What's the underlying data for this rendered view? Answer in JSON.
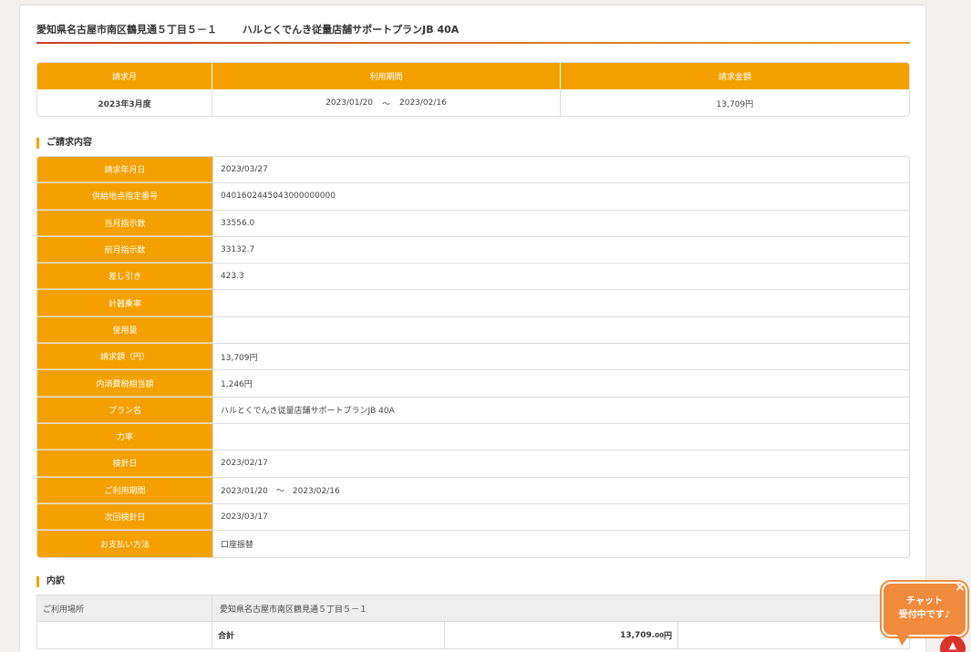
{
  "header": {
    "address": "愛知県名古屋市南区鶴見通５丁目５－１",
    "plan": "ハルとくでんき従量店舗サポートプランJB 40A"
  },
  "summary": {
    "headers": [
      "請求月",
      "利用期間",
      "請求金額"
    ],
    "month": "2023年3月度",
    "period_start": "2023/01/20",
    "period_sep": "〜",
    "period_end": "2023/02/16",
    "amount": "13,709円"
  },
  "details": {
    "heading": "ご請求内容",
    "rows": [
      {
        "label": "請求年月日",
        "value": "2023/03/27"
      },
      {
        "label": "供給地点指定番号",
        "value": "0401602445043000000000"
      },
      {
        "label": "当月指示数",
        "value": "33556.0"
      },
      {
        "label": "前月指示数",
        "value": "33132.7"
      },
      {
        "label": "差し引き",
        "value": "423.3"
      },
      {
        "label": "計器乗率",
        "value": ""
      },
      {
        "label": "使用量",
        "value": ""
      },
      {
        "label": "請求額（円）",
        "value": "13,709円"
      },
      {
        "label": "内消費税相当額",
        "value": "1,246円"
      },
      {
        "label": "プラン名",
        "value": "ハルとくでんき従量店舗サポートプランJB 40A"
      },
      {
        "label": "力率",
        "value": ""
      },
      {
        "label": "検針日",
        "value": "2023/02/17"
      },
      {
        "label": "ご利用期間",
        "value": "2023/01/20　〜　2023/02/16"
      },
      {
        "label": "次回検針日",
        "value": "2023/03/17"
      },
      {
        "label": "お支払い方法",
        "value": "口座振替"
      }
    ]
  },
  "breakdown": {
    "heading": "内訳",
    "place_label": "ご利用場所",
    "place_value": "愛知県名古屋市南区鶴見通５丁目５－１",
    "total_label": "合計",
    "total_value": "13,709.",
    "total_decimal": "00",
    "total_unit": "円"
  },
  "chat": {
    "line1": "チャット",
    "line2": "受付中です♪",
    "close": "×"
  },
  "to_top": "▲"
}
